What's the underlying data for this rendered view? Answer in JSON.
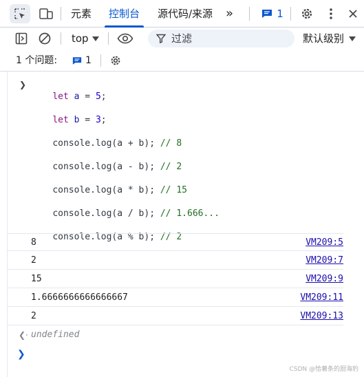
{
  "tabbar": {
    "tabs": [
      {
        "label": "元素"
      },
      {
        "label": "控制台"
      },
      {
        "label": "源代码/来源"
      }
    ],
    "more_label": "»",
    "issues_count": "1",
    "colors": {
      "accent": "#0b57d0"
    }
  },
  "toolbar": {
    "context": "top",
    "filter_placeholder": "过滤",
    "levels": "默认级别"
  },
  "issues": {
    "label": "1 个问题:",
    "count": "1"
  },
  "console": {
    "input": {
      "line1": {
        "kw": "let",
        "var": "a",
        "op": " = ",
        "num": "5",
        "end": ";"
      },
      "line2": {
        "kw": "let",
        "var": "b",
        "op": " = ",
        "num": "3",
        "end": ";"
      },
      "line3": {
        "code": "console.log(a + b); ",
        "comment": "// 8"
      },
      "line4": {
        "code": "console.log(a - b); ",
        "comment": "// 2"
      },
      "line5": {
        "code": "console.log(a * b); ",
        "comment": "// 15"
      },
      "line6": {
        "code": "console.log(a / b); ",
        "comment": "// 1.666..."
      },
      "line7": {
        "code": "console.log(a % b); ",
        "comment": "// 2"
      }
    },
    "logs": [
      {
        "value": "8",
        "source": "VM209:5"
      },
      {
        "value": "2",
        "source": "VM209:7"
      },
      {
        "value": "15",
        "source": "VM209:9"
      },
      {
        "value": "1.6666666666666667",
        "source": "VM209:11"
      },
      {
        "value": "2",
        "source": "VM209:13"
      }
    ],
    "return_value": "undefined",
    "watermark": "CSDN @恰薯条的厨海豹"
  }
}
